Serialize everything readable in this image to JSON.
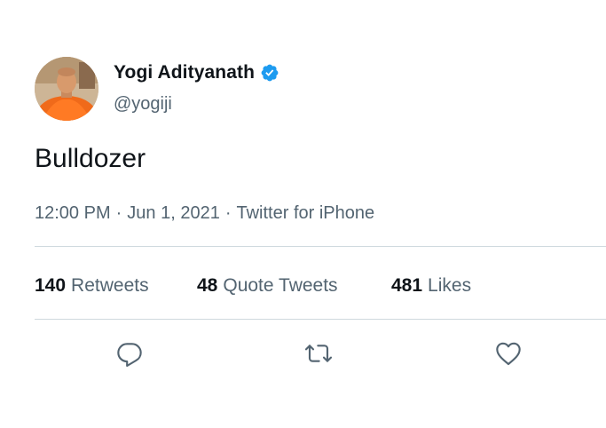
{
  "author": {
    "display_name": "Yogi Adityanath",
    "handle": "@yogiji",
    "verified": true,
    "avatar_icon": "profile-photo"
  },
  "tweet": {
    "text": "Bulldozer",
    "time": "12:00 PM",
    "date": "Jun 1, 2021",
    "source": "Twitter for iPhone",
    "separator": "·"
  },
  "stats": {
    "retweets_count": "140",
    "retweets_label": "Retweets",
    "quote_tweets_count": "48",
    "quote_tweets_label": "Quote Tweets",
    "likes_count": "481",
    "likes_label": "Likes"
  },
  "actions": {
    "reply_icon": "reply-icon",
    "retweet_icon": "retweet-icon",
    "like_icon": "heart-icon"
  },
  "colors": {
    "text_primary": "#0f1419",
    "text_secondary": "#536471",
    "verified_blue": "#1d9bf0",
    "divider": "#cfd9de"
  }
}
